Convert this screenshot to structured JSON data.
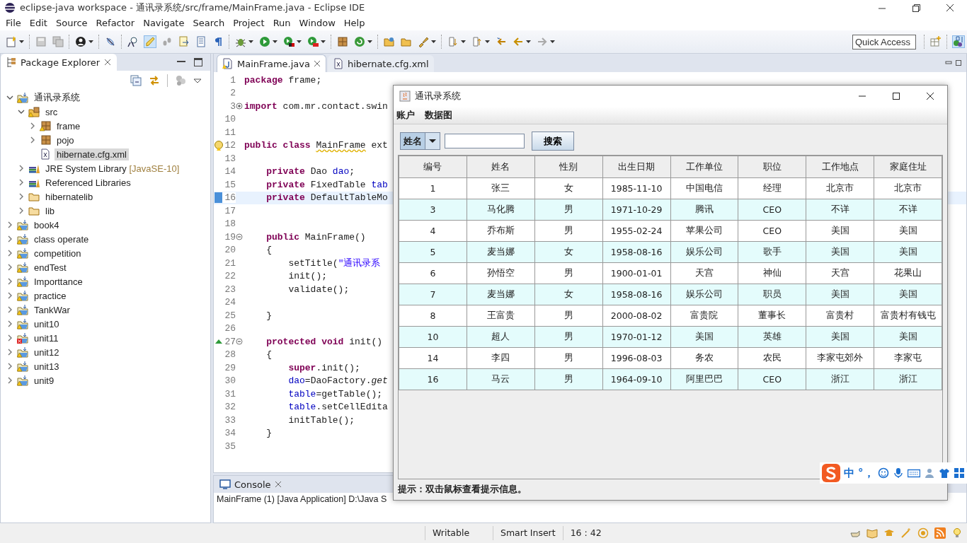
{
  "window": {
    "title": "eclipse-java workspace - 通讯录系统/src/frame/MainFrame.java - Eclipse IDE"
  },
  "menu": [
    "File",
    "Edit",
    "Source",
    "Refactor",
    "Navigate",
    "Search",
    "Project",
    "Run",
    "Window",
    "Help"
  ],
  "quick_access": {
    "placeholder": "Quick Access"
  },
  "package_explorer": {
    "title": "Package Explorer",
    "tree": [
      {
        "label": "通讯录系统",
        "kind": "project",
        "warning": true,
        "error": false,
        "expanded": true,
        "selected": false,
        "children": [
          {
            "label": "src",
            "kind": "source-folder",
            "warning": true,
            "error": false,
            "expanded": true,
            "selected": false,
            "children": [
              {
                "label": "frame",
                "kind": "package",
                "warning": true,
                "error": false,
                "expanded": false,
                "selected": false
              },
              {
                "label": "pojo",
                "kind": "package",
                "warning": false,
                "error": false,
                "expanded": false,
                "selected": false
              },
              {
                "label": "hibernate.cfg.xml",
                "kind": "xml-file",
                "warning": false,
                "error": false,
                "selected": true
              }
            ]
          },
          {
            "label": "JRE System Library",
            "suffix": "[JavaSE-10]",
            "kind": "library",
            "warning": false,
            "error": false,
            "expanded": false,
            "selected": false
          },
          {
            "label": "Referenced Libraries",
            "kind": "library",
            "warning": false,
            "error": false,
            "expanded": false,
            "selected": false
          },
          {
            "label": "hibernatelib",
            "kind": "folder",
            "warning": false,
            "error": false,
            "expanded": false,
            "selected": false
          },
          {
            "label": "lib",
            "kind": "folder",
            "warning": false,
            "error": false,
            "expanded": false,
            "selected": false
          }
        ]
      },
      {
        "label": "book4",
        "kind": "project",
        "warning": true,
        "error": false,
        "expanded": false,
        "selected": false
      },
      {
        "label": "class operate",
        "kind": "project",
        "warning": true,
        "error": false,
        "expanded": false,
        "selected": false
      },
      {
        "label": "competition",
        "kind": "project",
        "warning": true,
        "error": false,
        "expanded": false,
        "selected": false
      },
      {
        "label": "endTest",
        "kind": "project",
        "warning": true,
        "error": false,
        "expanded": false,
        "selected": false
      },
      {
        "label": "Importtance",
        "kind": "project",
        "warning": true,
        "error": false,
        "expanded": false,
        "selected": false
      },
      {
        "label": "practice",
        "kind": "project",
        "warning": true,
        "error": false,
        "expanded": false,
        "selected": false
      },
      {
        "label": "TankWar",
        "kind": "project",
        "warning": true,
        "error": false,
        "expanded": false,
        "selected": false
      },
      {
        "label": "unit10",
        "kind": "project",
        "warning": true,
        "error": false,
        "expanded": false,
        "selected": false
      },
      {
        "label": "unit11",
        "kind": "project",
        "warning": false,
        "error": true,
        "expanded": false,
        "selected": false
      },
      {
        "label": "unit12",
        "kind": "project",
        "warning": true,
        "error": false,
        "expanded": false,
        "selected": false
      },
      {
        "label": "unit13",
        "kind": "project",
        "warning": true,
        "error": false,
        "expanded": false,
        "selected": false
      },
      {
        "label": "unit9",
        "kind": "project",
        "warning": true,
        "error": false,
        "expanded": false,
        "selected": false
      }
    ]
  },
  "editor": {
    "tabs": [
      {
        "label": "MainFrame.java",
        "kind": "java",
        "selected": true
      },
      {
        "label": "hibernate.cfg.xml",
        "kind": "xml",
        "selected": false
      }
    ],
    "lines": [
      {
        "number": "1",
        "current": false,
        "segments": [
          {
            "kind": "keyword",
            "text": "package"
          },
          {
            "kind": "plain",
            "text": " frame;"
          }
        ]
      },
      {
        "number": "2",
        "current": false
      },
      {
        "number": "3",
        "current": false,
        "folded": true,
        "segments": [
          {
            "kind": "keyword",
            "text": "import"
          },
          {
            "kind": "plain",
            "text": " com.mr.contact.swin"
          }
        ]
      },
      {
        "number": "10",
        "current": false
      },
      {
        "number": "11",
        "current": false
      },
      {
        "number": "12",
        "current": false,
        "kind": "warning",
        "segments": [
          {
            "kind": "keyword",
            "text": "public class "
          },
          {
            "kind": "warned",
            "text": "MainFrame"
          },
          {
            "kind": "plain",
            "text": " ext"
          }
        ]
      },
      {
        "number": "13",
        "current": false
      },
      {
        "number": "14",
        "current": false,
        "segments": [
          {
            "kind": "keyword",
            "text": "    private"
          },
          {
            "kind": "plain",
            "text": " Dao "
          },
          {
            "kind": "field",
            "text": "dao"
          },
          {
            "kind": "plain",
            "text": ";"
          }
        ]
      },
      {
        "number": "15",
        "current": false,
        "segments": [
          {
            "kind": "keyword",
            "text": "    private"
          },
          {
            "kind": "plain",
            "text": " FixedTable "
          },
          {
            "kind": "field",
            "text": "tab"
          }
        ]
      },
      {
        "number": "16",
        "current": true,
        "kind": "bookmark",
        "segments": [
          {
            "kind": "keyword",
            "text": "    private"
          },
          {
            "kind": "plain",
            "text": " DefaultTableMo"
          }
        ]
      },
      {
        "number": "17",
        "current": false
      },
      {
        "number": "18",
        "current": false
      },
      {
        "number": "19",
        "current": false,
        "folded": false,
        "segments": [
          {
            "kind": "keyword",
            "text": "    public"
          },
          {
            "kind": "plain",
            "text": " MainFrame()"
          }
        ]
      },
      {
        "number": "20",
        "current": false,
        "segments": [
          {
            "kind": "plain",
            "text": "    {"
          }
        ]
      },
      {
        "number": "21",
        "current": false,
        "segments": [
          {
            "kind": "plain",
            "text": "        setTitle("
          },
          {
            "kind": "string",
            "text": "\"通讯录系"
          }
        ]
      },
      {
        "number": "22",
        "current": false,
        "segments": [
          {
            "kind": "plain",
            "text": "        init();"
          }
        ]
      },
      {
        "number": "23",
        "current": false,
        "segments": [
          {
            "kind": "plain",
            "text": "        validate();"
          }
        ]
      },
      {
        "number": "24",
        "current": false
      },
      {
        "number": "25",
        "current": false,
        "segments": [
          {
            "kind": "plain",
            "text": "    }"
          }
        ]
      },
      {
        "number": "26",
        "current": false
      },
      {
        "number": "27",
        "current": false,
        "folded": false,
        "kind": "override",
        "segments": [
          {
            "kind": "keyword",
            "text": "    protected void"
          },
          {
            "kind": "plain",
            "text": " init()"
          }
        ]
      },
      {
        "number": "28",
        "current": false,
        "segments": [
          {
            "kind": "plain",
            "text": "    {"
          }
        ]
      },
      {
        "number": "29",
        "current": false,
        "segments": [
          {
            "kind": "keyword",
            "text": "        super"
          },
          {
            "kind": "plain",
            "text": ".init();"
          }
        ]
      },
      {
        "number": "30",
        "current": false,
        "segments": [
          {
            "kind": "field",
            "text": "        dao"
          },
          {
            "kind": "plain",
            "text": "=DaoFactory."
          },
          {
            "kind": "static",
            "text": "get"
          }
        ]
      },
      {
        "number": "31",
        "current": false,
        "segments": [
          {
            "kind": "field",
            "text": "        table"
          },
          {
            "kind": "plain",
            "text": "=getTable();"
          }
        ]
      },
      {
        "number": "32",
        "current": false,
        "segments": [
          {
            "kind": "field",
            "text": "        table"
          },
          {
            "kind": "plain",
            "text": ".setCellEdita"
          }
        ]
      },
      {
        "number": "33",
        "current": false,
        "segments": [
          {
            "kind": "plain",
            "text": "        initTable();"
          }
        ]
      },
      {
        "number": "34",
        "current": false,
        "segments": [
          {
            "kind": "plain",
            "text": "    }"
          }
        ]
      },
      {
        "number": "35",
        "current": false
      }
    ]
  },
  "console": {
    "title": "Console",
    "text": "MainFrame (1) [Java Application] D:\\Java S"
  },
  "status_bar": [
    "Writable",
    "Smart Insert",
    "16 : 42"
  ],
  "app_window": {
    "title": "通讯录系统",
    "menu": [
      "账户",
      "数据图"
    ],
    "search_by": "姓名",
    "search_button": "搜索",
    "table": {
      "columns": [
        "编号",
        "姓名",
        "性别",
        "出生日期",
        "工作单位",
        "职位",
        "工作地点",
        "家庭住址"
      ],
      "rows": [
        [
          "1",
          "张三",
          "女",
          "1985-11-10",
          "中国电信",
          "经理",
          "北京市",
          "北京市"
        ],
        [
          "3",
          "马化腾",
          "男",
          "1971-10-29",
          "腾讯",
          "CEO",
          "不详",
          "不详"
        ],
        [
          "4",
          "乔布斯",
          "男",
          "1955-02-24",
          "苹果公司",
          "CEO",
          "美国",
          "美国"
        ],
        [
          "5",
          "麦当娜",
          "女",
          "1958-08-16",
          "娱乐公司",
          "歌手",
          "美国",
          "美国"
        ],
        [
          "6",
          "孙悟空",
          "男",
          "1900-01-01",
          "天宫",
          "神仙",
          "天宫",
          "花果山"
        ],
        [
          "7",
          "麦当娜",
          "女",
          "1958-08-16",
          "娱乐公司",
          "职员",
          "美国",
          "美国"
        ],
        [
          "8",
          "王富贵",
          "男",
          "2000-08-02",
          "富贵院",
          "董事长",
          "富贵村",
          "富贵村有钱屯"
        ],
        [
          "10",
          "超人",
          "男",
          "1970-01-12",
          "美国",
          "英雄",
          "美国",
          "美国"
        ],
        [
          "14",
          "李四",
          "男",
          "1996-08-03",
          "务农",
          "农民",
          "李家屯郊外",
          "李家屯"
        ],
        [
          "16",
          "马云",
          "男",
          "1964-09-10",
          "阿里巴巴",
          "CEO",
          "浙江",
          "浙江"
        ]
      ]
    },
    "status": "提示：双击鼠标查看提示信息。"
  },
  "ime_bar": {
    "mode": "中",
    "punctuation": "°，"
  }
}
